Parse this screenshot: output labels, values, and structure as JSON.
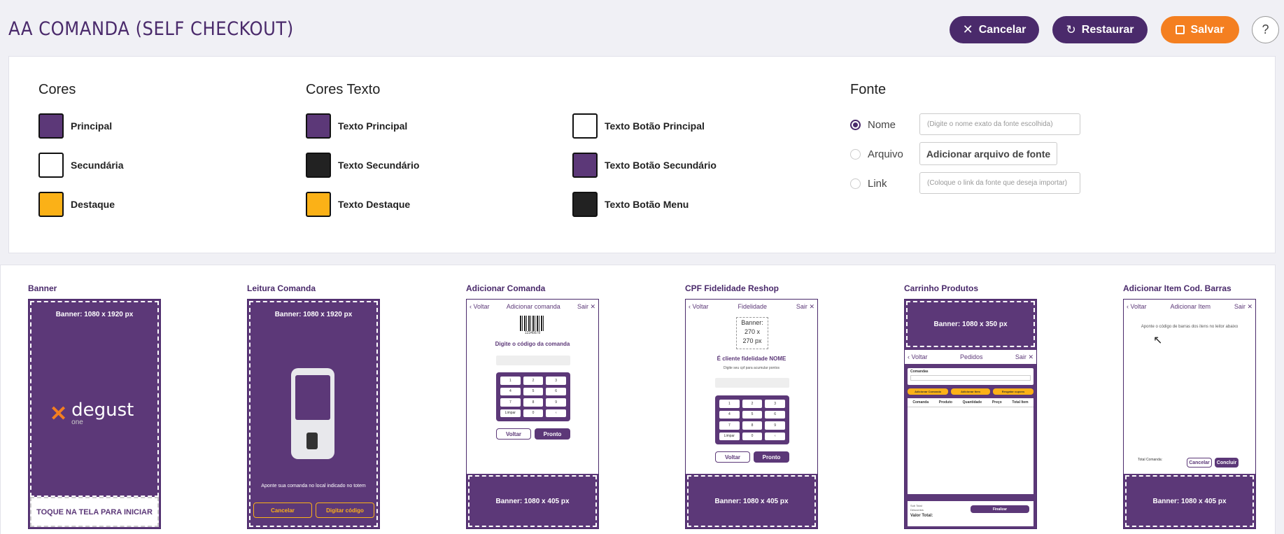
{
  "header": {
    "title": "AA COMANDA (SELF CHECKOUT)",
    "cancel_label": "Cancelar",
    "restore_label": "Restaurar",
    "save_label": "Salvar",
    "help_label": "?"
  },
  "colors": {
    "section_title": "Cores",
    "items": [
      {
        "label": "Principal",
        "color": "#5c3878"
      },
      {
        "label": "Secundária",
        "color": "#ffffff"
      },
      {
        "label": "Destaque",
        "color": "#fbb117"
      }
    ]
  },
  "text_colors": {
    "section_title": "Cores Texto",
    "items": [
      {
        "label": "Texto Principal",
        "color": "#5c3878"
      },
      {
        "label": "Texto Secundário",
        "color": "#222222"
      },
      {
        "label": "Texto Destaque",
        "color": "#fbb117"
      },
      {
        "label": "Texto Botão Principal",
        "color": "#ffffff"
      },
      {
        "label": "Texto Botão Secundário",
        "color": "#5c3878"
      },
      {
        "label": "Texto Botão Menu",
        "color": "#222222"
      }
    ]
  },
  "font": {
    "section_title": "Fonte",
    "options": [
      {
        "label": "Nome",
        "selected": true
      },
      {
        "label": "Arquivo",
        "selected": false
      },
      {
        "label": "Link",
        "selected": false
      }
    ],
    "name_placeholder": "(Digite o nome exato da fonte escolhida)",
    "file_button": "Adicionar arquivo de fonte",
    "link_placeholder": "(Coloque o link da fonte que deseja importar)"
  },
  "previews": {
    "banner": {
      "label": "Banner",
      "banner_text": "Banner: 1080 x 1920 px",
      "logo_text": "degust",
      "logo_sub": "one",
      "footer": "TOQUE NA TELA PARA INICIAR"
    },
    "leitura": {
      "label": "Leitura Comanda",
      "banner_text": "Banner: 1080 x 1920 px",
      "instruction": "Aponte sua comanda no local indicado no totem",
      "cancel": "Cancelar",
      "type_code": "Digitar código"
    },
    "adicionar": {
      "label": "Adicionar Comanda",
      "back": "Voltar",
      "title": "Adicionar comanda",
      "exit": "Sair",
      "barcode_number": "12345678",
      "prompt": "Digite o código da comanda",
      "btn_back": "Voltar",
      "btn_ready": "Pronto",
      "banner_text": "Banner: 1080 x 405 px"
    },
    "cpf": {
      "label": "CPF Fidelidade Reshop",
      "back": "Voltar",
      "title": "Fidelidade",
      "exit": "Sair",
      "banner_small": "Banner:\n270 x\n270 px",
      "question": "É cliente fidelidade NOME",
      "hint": "Digite seu cpf para acumular pontos",
      "btn_back": "Voltar",
      "btn_ready": "Pronto",
      "banner_text": "Banner: 1080 x 405 px"
    },
    "carrinho": {
      "label": "Carrinho Produtos",
      "banner_text": "Banner: 1080 x 350 px",
      "back": "Voltar",
      "title": "Pedidos",
      "exit": "Sair",
      "comandas": "Comandas",
      "add_comanda": "Adicionar Comanda",
      "add_item": "Adicionar Item",
      "redeem": "Resgatar cupons",
      "cols": [
        "Comanda",
        "Produto",
        "Quantidade",
        "Preço",
        "Total Item"
      ],
      "sub_total": "Sub Total",
      "descontos": "Descontos",
      "valor_total": "Valor Total:",
      "finalizar": "Finalizar"
    },
    "codbarras": {
      "label": "Adicionar Item Cod. Barras",
      "back": "Voltar",
      "title": "Adicionar Item",
      "exit": "Sair",
      "instruction": "Aponte o código de barras dos itens no leitor abaixo",
      "total": "Total Comanda:",
      "cancel": "Cancelar",
      "conclude": "Concluir",
      "banner_text": "Banner: 1080 x 405 px"
    }
  }
}
